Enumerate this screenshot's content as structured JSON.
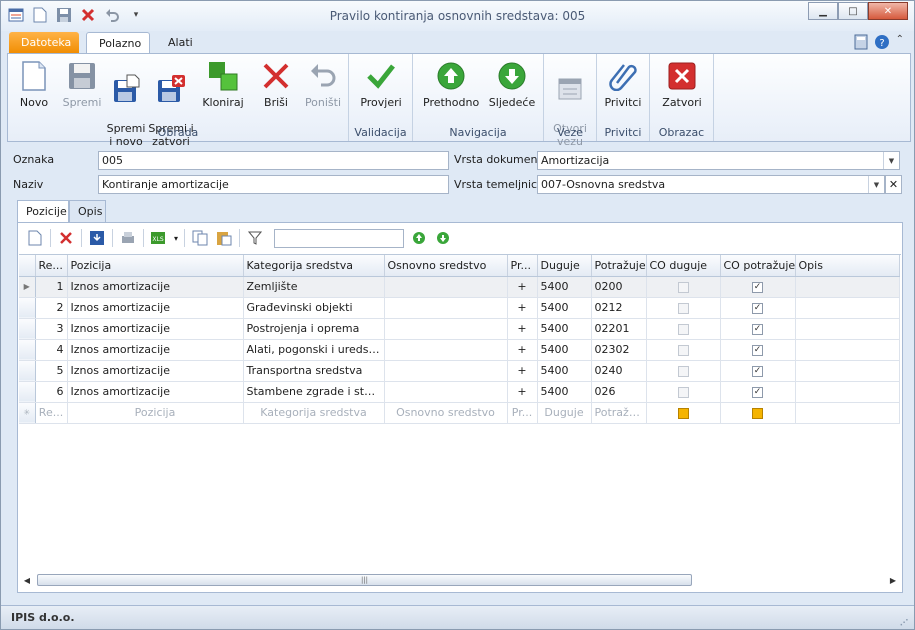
{
  "window": {
    "title": "Pravilo kontiranja osnovnih sredstava: 005"
  },
  "ribbon_tabs": [
    "Datoteka",
    "Polazno",
    "Alati"
  ],
  "ribbon": {
    "groups": [
      {
        "title": "Obrada",
        "buttons": [
          "Novo",
          "Spremi",
          "Spremi\ni novo",
          "Spremi i\nzatvori",
          "Kloniraj",
          "Briši",
          "Poništi"
        ]
      },
      {
        "title": "Validacija",
        "buttons": [
          "Provjeri"
        ]
      },
      {
        "title": "Navigacija",
        "buttons": [
          "Prethodno",
          "Sljedeće"
        ]
      },
      {
        "title": "Veze",
        "buttons": [
          "Otvori\nvezu"
        ]
      },
      {
        "title": "Privitci",
        "buttons": [
          "Privitci"
        ]
      },
      {
        "title": "Obrazac",
        "buttons": [
          "Zatvori"
        ]
      }
    ]
  },
  "form": {
    "oznaka_label": "Oznaka",
    "oznaka_value": "005",
    "naziv_label": "Naziv",
    "naziv_value": "Kontiranje amortizacije",
    "vrsta_dokumenta_label": "Vrsta dokumenta",
    "vrsta_dokumenta_value": "Amortizacija",
    "vrsta_temeljnice_label": "Vrsta temeljnice",
    "vrsta_temeljnice_value": "007-Osnovna sredstva"
  },
  "panel_tabs": [
    "Pozicije",
    "Opis"
  ],
  "grid": {
    "columns": [
      "Re...",
      "Pozicija",
      "Kategorija sredstva",
      "Osnovno sredstvo",
      "Pr...",
      "Duguje",
      "Potražuje",
      "CO duguje",
      "CO potražuje",
      "Opis"
    ],
    "rows": [
      {
        "rb": "1",
        "pozicija": "Iznos amortizacije",
        "kategorija": "Zemljište",
        "osnovno": "",
        "pr": "+",
        "duguje": "5400",
        "potrazuje": "0200",
        "co_duguje": false,
        "co_potrazuje": true,
        "opis": ""
      },
      {
        "rb": "2",
        "pozicija": "Iznos amortizacije",
        "kategorija": "Građevinski objekti",
        "osnovno": "",
        "pr": "+",
        "duguje": "5400",
        "potrazuje": "0212",
        "co_duguje": false,
        "co_potrazuje": true,
        "opis": ""
      },
      {
        "rb": "3",
        "pozicija": "Iznos amortizacije",
        "kategorija": "Postrojenja i oprema",
        "osnovno": "",
        "pr": "+",
        "duguje": "5400",
        "potrazuje": "02201",
        "co_duguje": false,
        "co_potrazuje": true,
        "opis": ""
      },
      {
        "rb": "4",
        "pozicija": "Iznos amortizacije",
        "kategorija": "Alati, pogonski i uredski n...",
        "osnovno": "",
        "pr": "+",
        "duguje": "5400",
        "potrazuje": "02302",
        "co_duguje": false,
        "co_potrazuje": true,
        "opis": ""
      },
      {
        "rb": "5",
        "pozicija": "Iznos amortizacije",
        "kategorija": "Transportna sredstva",
        "osnovno": "",
        "pr": "+",
        "duguje": "5400",
        "potrazuje": "0240",
        "co_duguje": false,
        "co_potrazuje": true,
        "opis": ""
      },
      {
        "rb": "6",
        "pozicija": "Iznos amortizacije",
        "kategorija": "Stambene zgrade i stanovi",
        "osnovno": "",
        "pr": "+",
        "duguje": "5400",
        "potrazuje": "026",
        "co_duguje": false,
        "co_potrazuje": true,
        "opis": ""
      }
    ],
    "new_row": {
      "rb": "Re...",
      "pozicija": "Pozicija",
      "kategorija": "Kategorija sredstva",
      "osnovno": "Osnovno sredstvo",
      "pr": "Pr...",
      "duguje": "Duguje",
      "potrazuje": "Potražuje"
    }
  },
  "statusbar": {
    "company": "IPIS d.o.o."
  },
  "colors": {
    "accent": "#f08c00",
    "green": "#3aa63a",
    "red": "#d32f2f"
  }
}
